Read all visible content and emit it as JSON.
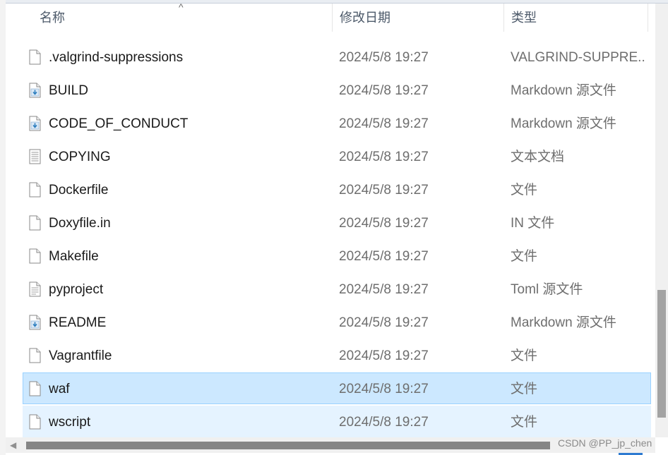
{
  "columns": {
    "name": "名称",
    "date": "修改日期",
    "type": "类型"
  },
  "sort_indicator": "^",
  "files": [
    {
      "name": ".valgrind-suppressions",
      "date": "2024/5/8 19:27",
      "type": "VALGRIND-SUPPRE...",
      "icon": "file-icon",
      "state": "normal"
    },
    {
      "name": "BUILD",
      "date": "2024/5/8 19:27",
      "type": "Markdown 源文件",
      "icon": "markdown-file-icon",
      "state": "normal"
    },
    {
      "name": "CODE_OF_CONDUCT",
      "date": "2024/5/8 19:27",
      "type": "Markdown 源文件",
      "icon": "markdown-file-icon",
      "state": "normal"
    },
    {
      "name": "COPYING",
      "date": "2024/5/8 19:27",
      "type": "文本文档",
      "icon": "text-file-icon",
      "state": "normal"
    },
    {
      "name": "Dockerfile",
      "date": "2024/5/8 19:27",
      "type": "文件",
      "icon": "file-icon",
      "state": "normal"
    },
    {
      "name": "Doxyfile.in",
      "date": "2024/5/8 19:27",
      "type": "IN 文件",
      "icon": "file-icon",
      "state": "normal"
    },
    {
      "name": "Makefile",
      "date": "2024/5/8 19:27",
      "type": "文件",
      "icon": "file-icon",
      "state": "normal"
    },
    {
      "name": "pyproject",
      "date": "2024/5/8 19:27",
      "type": "Toml 源文件",
      "icon": "lined-file-icon",
      "state": "normal"
    },
    {
      "name": "README",
      "date": "2024/5/8 19:27",
      "type": "Markdown 源文件",
      "icon": "markdown-file-icon",
      "state": "normal"
    },
    {
      "name": "Vagrantfile",
      "date": "2024/5/8 19:27",
      "type": "文件",
      "icon": "file-icon",
      "state": "normal"
    },
    {
      "name": "waf",
      "date": "2024/5/8 19:27",
      "type": "文件",
      "icon": "file-icon",
      "state": "selected"
    },
    {
      "name": "wscript",
      "date": "2024/5/8 19:27",
      "type": "文件",
      "icon": "file-icon",
      "state": "hover"
    }
  ],
  "watermark": "CSDN @PP_jp_chen",
  "colors": {
    "selected_bg": "#cce8ff",
    "selected_border": "#99d1ff",
    "hover_bg": "#e5f3ff",
    "markdown_arrow": "#2f7fbf"
  }
}
